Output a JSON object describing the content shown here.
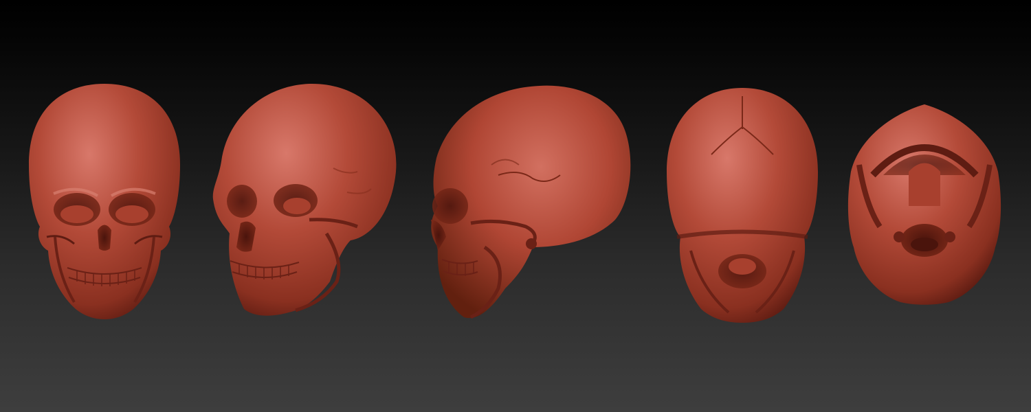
{
  "scene": {
    "background_top": "#000000",
    "background_bottom": "#3e3e3e",
    "material_color": "#b34a38",
    "material_shadow": "#6a2116",
    "material_highlight": "#d8786a"
  },
  "views": [
    {
      "id": "front",
      "icon": "skull-front-view-icon"
    },
    {
      "id": "three-quarter",
      "icon": "skull-three-quarter-view-icon"
    },
    {
      "id": "side",
      "icon": "skull-side-view-icon"
    },
    {
      "id": "back",
      "icon": "skull-back-view-icon"
    },
    {
      "id": "bottom",
      "icon": "skull-bottom-view-icon"
    }
  ]
}
